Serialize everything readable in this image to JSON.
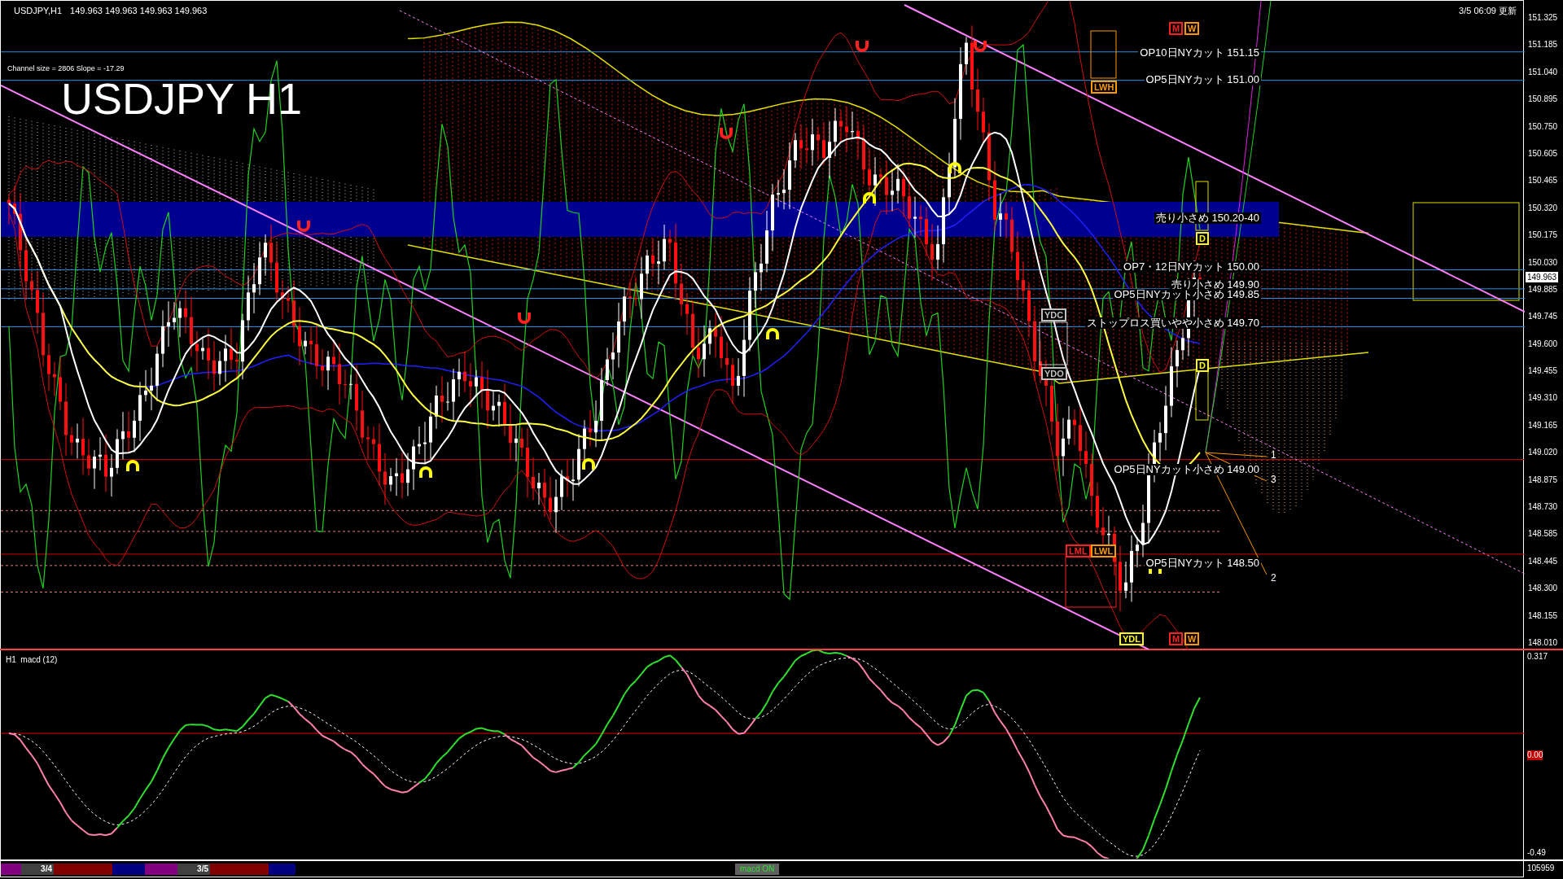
{
  "header": {
    "symbol": "USDJPY,H1",
    "prices": "149.963 149.963 149.963 149.963",
    "updated": "3/5 06:09 更新"
  },
  "chart_title": "USDJPY H1",
  "channel_info": "Channel size = 2806 Slope = -17.29",
  "annotations": [
    {
      "text": "OP10日NYカット 151.15"
    },
    {
      "text": "OP5日NYカット 151.00"
    },
    {
      "text": "売り小さめ 150.20-40"
    },
    {
      "text": "OP7・12日NYカット 150.00"
    },
    {
      "text": "売り小さめ 149.90"
    },
    {
      "text": "OP5日NYカット小さめ 149.85"
    },
    {
      "text": "ストップロス買いやや小さめ 149.70"
    },
    {
      "text": "OP5日NYカット小さめ 149.00"
    },
    {
      "text": "OP5日NYカット 148.50"
    }
  ],
  "level_tags": [
    {
      "text": "M",
      "color": "#ff2020"
    },
    {
      "text": "W",
      "color": "#ff9900"
    },
    {
      "text": "LWH",
      "color": "#ff9900"
    },
    {
      "text": "D",
      "color": "#ffff00"
    },
    {
      "text": "YDC",
      "color": "#c0c0c0"
    },
    {
      "text": "D",
      "color": "#ffff00"
    },
    {
      "text": "YDO",
      "color": "#c0c0c0"
    },
    {
      "text": "LML",
      "color": "#ff2020"
    },
    {
      "text": "LWL",
      "color": "#ff9900"
    },
    {
      "text": "YDL",
      "color": "#ffff00"
    },
    {
      "text": "M",
      "color": "#ff2020"
    },
    {
      "text": "W",
      "color": "#ff9900"
    }
  ],
  "wave_labels": [
    "1",
    "3",
    "2"
  ],
  "price_axis": {
    "ticks": [
      "151.325",
      "151.185",
      "151.040",
      "150.895",
      "150.750",
      "150.605",
      "150.465",
      "150.320",
      "150.175",
      "150.030",
      "149.885",
      "149.745",
      "149.600",
      "149.455",
      "149.310",
      "149.165",
      "149.020",
      "148.875",
      "148.730",
      "148.585",
      "148.445",
      "148.300",
      "148.155",
      "148.010"
    ],
    "current_price": "149.963"
  },
  "macd_panel": {
    "label": "H1  macd (12)",
    "ticks": [
      "0.317",
      "0.00",
      "-0.49"
    ],
    "volume": "105959"
  },
  "session_bar": {
    "segments": [
      {
        "color": "#800080"
      },
      {
        "color": "#404040",
        "label": "3/4"
      },
      {
        "color": "#800000"
      },
      {
        "color": "#000080"
      },
      {
        "color": "#800080"
      },
      {
        "color": "#404040",
        "label": "3/5"
      },
      {
        "color": "#800000"
      },
      {
        "color": "#000080"
      }
    ],
    "button": "macd ON"
  }
}
